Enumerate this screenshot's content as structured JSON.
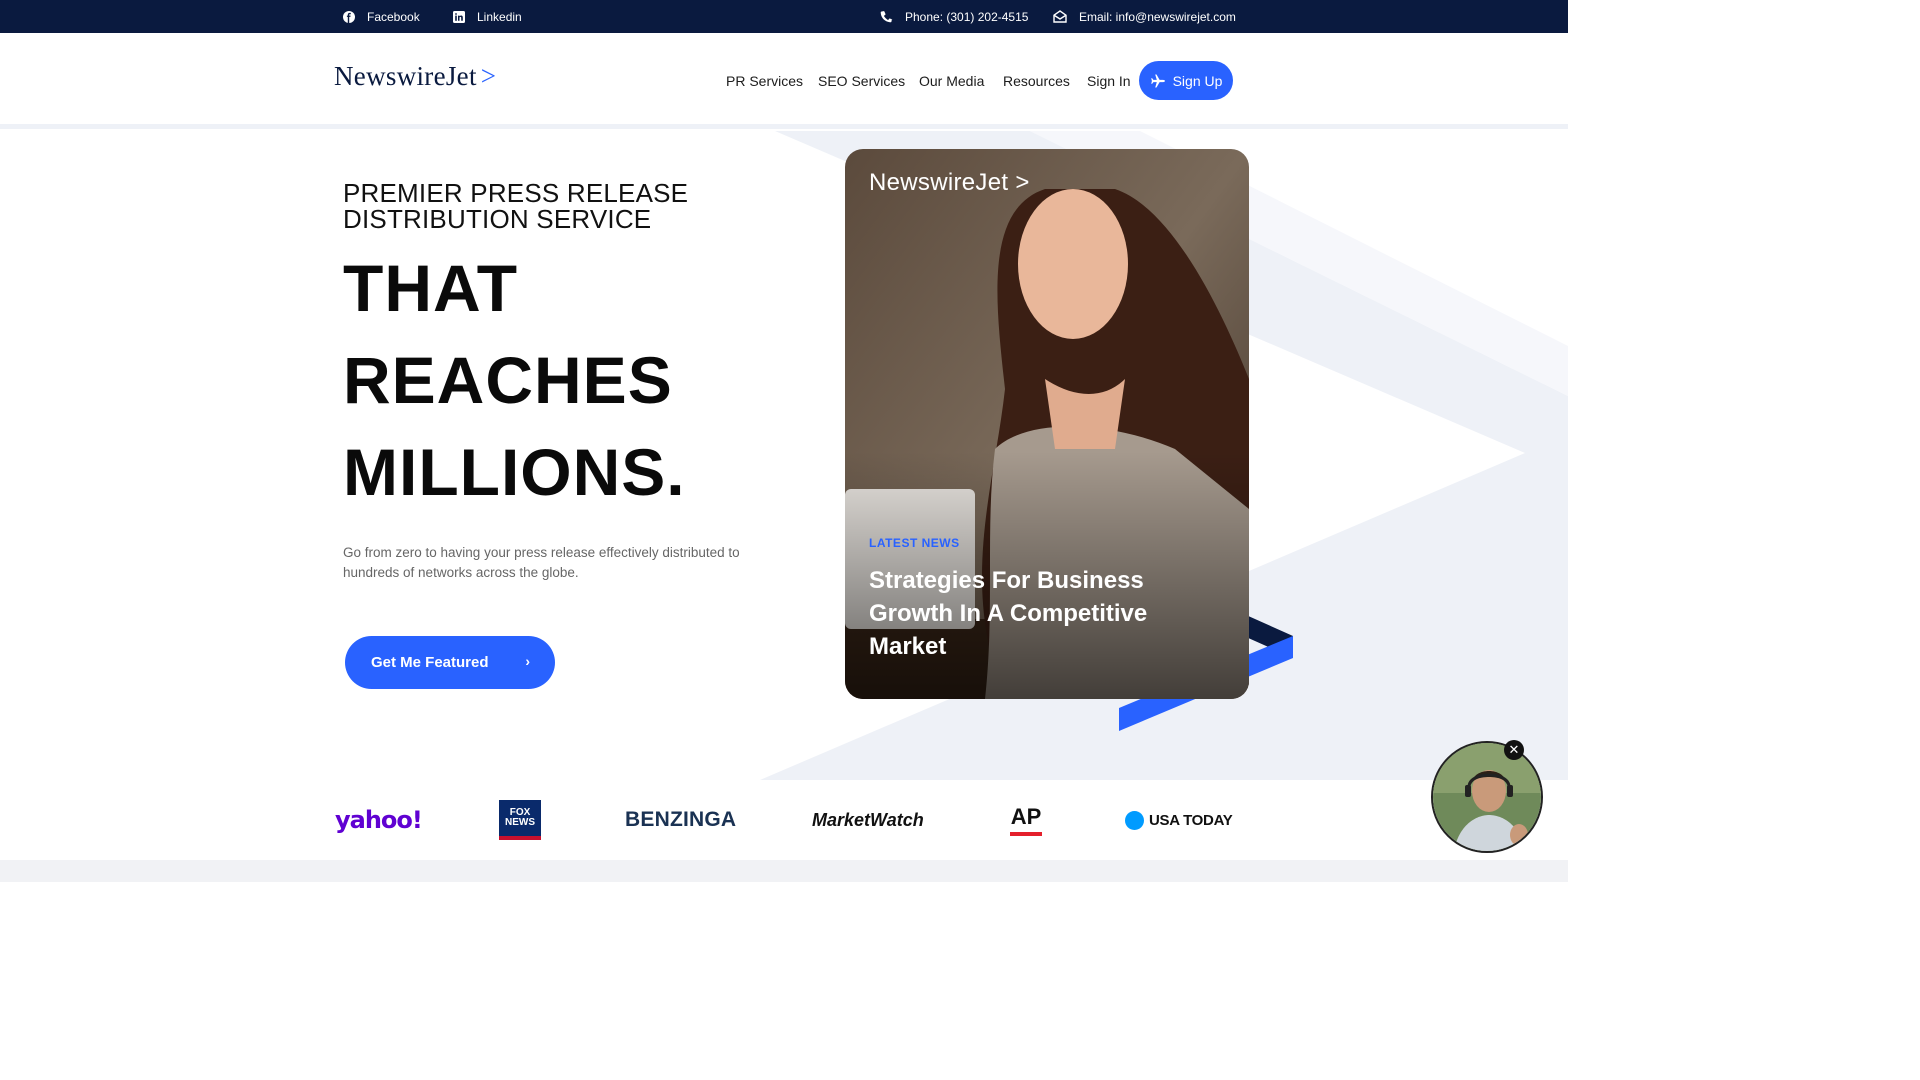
{
  "topbar": {
    "facebook": "Facebook",
    "linkedin": "Linkedin",
    "phone": "Phone: (301) 202-4515",
    "email": "Email: info@newswirejet.com"
  },
  "header": {
    "logo_text": "NewswireJet",
    "logo_arrow": ">",
    "nav": [
      "PR Services",
      "SEO Services",
      "Our Media",
      "Resources",
      "Sign In"
    ],
    "signup": "Sign Up"
  },
  "hero": {
    "kicker_line1": "PREMIER PRESS RELEASE",
    "kicker_line2": "DISTRIBUTION SERVICE",
    "big_line1": "THAT",
    "big_line2": "REACHES",
    "big_line3": "MILLIONS.",
    "description": "Go from zero to having your press release effectively distributed to hundreds of networks across the globe.",
    "cta": "Get Me Featured",
    "cta_chevron": "›"
  },
  "card": {
    "logo_text": "NewswireJet",
    "logo_arrow": ">",
    "kicker": "LATEST NEWS",
    "title": "Strategies For Business Growth In A Competitive Market"
  },
  "media_logos": [
    "yahoo!",
    "FOX NEWS",
    "BENZINGA",
    "MarketWatch",
    "AP",
    "USA TODAY"
  ],
  "bubble": {
    "close": "✕"
  },
  "colors": {
    "navy": "#0a1a3f",
    "accent": "#2962ff",
    "yahoo": "#6001d2",
    "ap_red": "#e4202c",
    "usa_blue": "#009bff"
  }
}
